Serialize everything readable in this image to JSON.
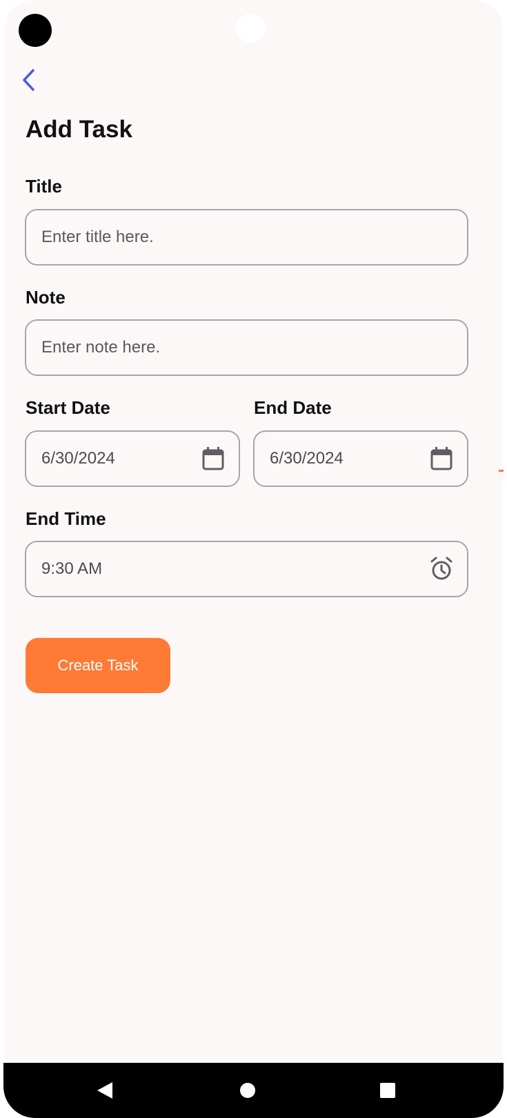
{
  "screen": {
    "title": "Add Task"
  },
  "form": {
    "title_label": "Title",
    "title_placeholder": "Enter title here.",
    "note_label": "Note",
    "note_placeholder": "Enter note here.",
    "start_date_label": "Start Date",
    "start_date_value": "6/30/2024",
    "end_date_label": "End Date",
    "end_date_value": "6/30/2024",
    "end_time_label": "End Time",
    "end_time_value": "9:30 AM",
    "submit_label": "Create Task"
  },
  "icons": {
    "back": "chevron-left-icon",
    "start_date": "calendar-icon",
    "end_date": "calendar-icon",
    "end_time": "alarm-clock-icon",
    "nav_back": "triangle-back-icon",
    "nav_home": "circle-home-icon",
    "nav_recents": "square-recents-icon"
  },
  "colors": {
    "accent": "#ff7a35",
    "back_icon": "#4a5be0",
    "background": "#fcf8f8",
    "field_border": "#a8a3ab",
    "icon_gray": "#5f5d63"
  }
}
